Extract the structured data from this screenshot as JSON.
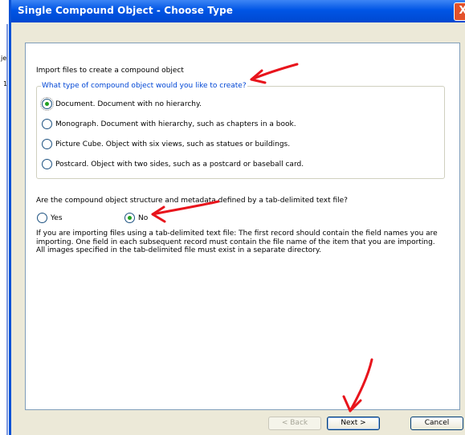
{
  "background": {
    "left_text_1": "je",
    "left_text_2": "1"
  },
  "dialog": {
    "title": "Single Compound Object - Choose Type",
    "close_glyph": "X"
  },
  "main": {
    "import_label": "Import files to create a compound object",
    "type_group": {
      "legend": "What type of compound object would you like to create?",
      "selected": "document",
      "options": [
        {
          "id": "document",
          "label": "Document. Document with no hierarchy."
        },
        {
          "id": "monograph",
          "label": "Monograph. Document with hierarchy, such as chapters in a book."
        },
        {
          "id": "picture-cube",
          "label": "Picture Cube. Object with six views, such as statues or buildings."
        },
        {
          "id": "postcard",
          "label": "Postcard. Object with two sides, such as a postcard or baseball card."
        }
      ]
    },
    "delimited_question": "Are the compound object structure and metadata defined by a tab-delimited text file?",
    "delimited_options": {
      "yes": "Yes",
      "no": "No",
      "selected": "no"
    },
    "help_text": "If you are importing files using a tab-delimited text file:  The first record should contain the field names you are importing. One field in each subsequent record must contain the file name of the item that you are importing. All images specified in the tab-delimited file must exist in a separate directory."
  },
  "buttons": {
    "back": "< Back",
    "next": "Next >",
    "cancel": "Cancel"
  },
  "colors": {
    "title_bar": "#0055e5",
    "dialog_face": "#ece9d8",
    "legend_text": "#0046d5",
    "annotation_arrow": "#e8141c"
  }
}
